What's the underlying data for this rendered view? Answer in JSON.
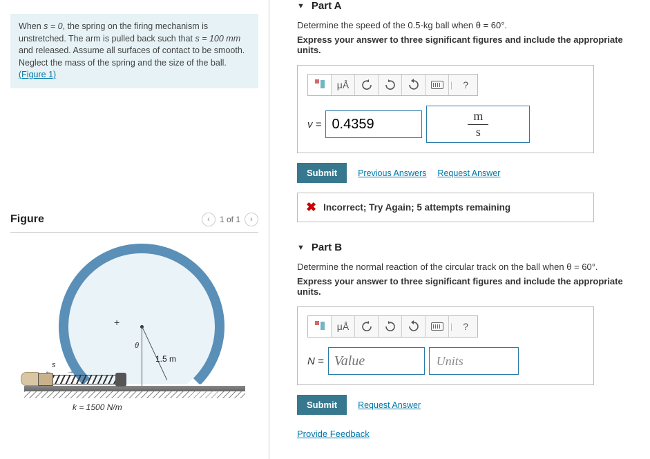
{
  "problem": {
    "text_prefix": "When ",
    "s_eq": "s = 0",
    "text_mid1": ", the spring on the firing mechanism is unstretched. The arm is pulled back such that ",
    "s_val": "s = 100 mm",
    "text_mid2": " and released. Assume all surfaces of contact to be smooth. Neglect the mass of the spring and the size of the ball. ",
    "figure_link": "(Figure 1)"
  },
  "figure": {
    "title": "Figure",
    "counter": "1 of 1",
    "radius_label": "1.5 m",
    "theta_label": "θ",
    "s_label": "s",
    "k_label": "k = 1500 N/m"
  },
  "partA": {
    "header": "Part A",
    "prompt": "Determine the speed of the 0.5-kg ball when θ = 60°.",
    "instruction": "Express your answer to three significant figures and include the appropriate units.",
    "var_label": "v =",
    "value": "0.4359",
    "unit_num": "m",
    "unit_den": "s",
    "submit": "Submit",
    "prev_answers": "Previous Answers",
    "request_answer": "Request Answer",
    "feedback": "Incorrect; Try Again; 5 attempts remaining"
  },
  "partB": {
    "header": "Part B",
    "prompt": "Determine the normal reaction of the circular track on the ball when θ = 60°.",
    "instruction": "Express your answer to three significant figures and include the appropriate units.",
    "var_label": "N =",
    "value_placeholder": "Value",
    "units_placeholder": "Units",
    "submit": "Submit",
    "request_answer": "Request Answer"
  },
  "footer": {
    "provide_feedback": "Provide Feedback"
  },
  "toolbar": {
    "mu_a": "μÅ",
    "help": "?"
  }
}
